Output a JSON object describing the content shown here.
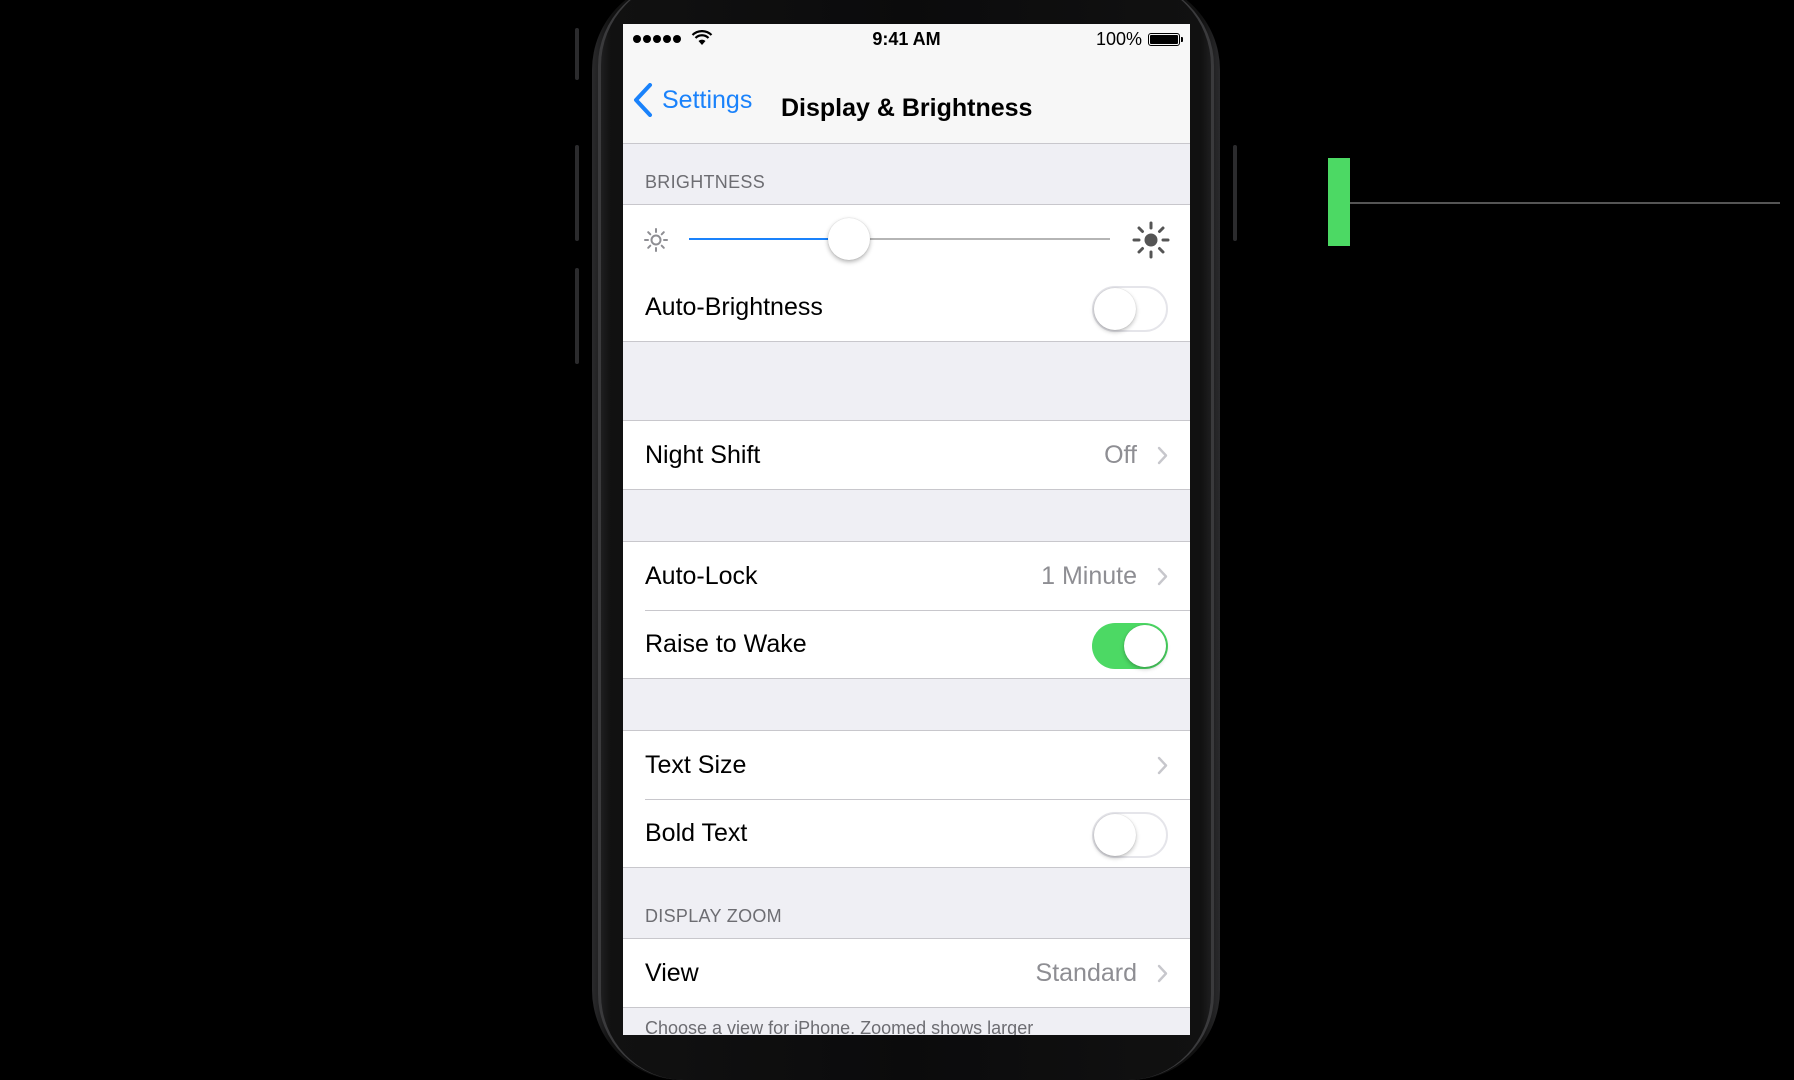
{
  "status_bar": {
    "time": "9:41 AM",
    "battery": "100%",
    "signal_bars": 5
  },
  "nav": {
    "back_label": "Settings",
    "title": "Display & Brightness"
  },
  "sections": {
    "brightness": {
      "header": "BRIGHTNESS",
      "slider_level": 0.38,
      "auto_brightness": {
        "label": "Auto-Brightness",
        "on": false
      }
    },
    "night_shift": {
      "label": "Night Shift",
      "value": "Off"
    },
    "lock": {
      "auto_lock": {
        "label": "Auto-Lock",
        "value": "1 Minute"
      },
      "raise_to_wake": {
        "label": "Raise to Wake",
        "on": true
      }
    },
    "text": {
      "text_size": {
        "label": "Text Size"
      },
      "bold_text": {
        "label": "Bold Text",
        "on": false
      }
    },
    "display_zoom": {
      "header": "DISPLAY ZOOM",
      "view": {
        "label": "View",
        "value": "Standard"
      },
      "footer": "Choose a view for iPhone. Zoomed shows larger"
    }
  },
  "colors": {
    "accent": "#1a82fb",
    "toggle_on": "#4cd964",
    "background": "#efeff4",
    "indicator": "#4cd964"
  },
  "icons": [
    "wifi-icon",
    "back-chevron-icon",
    "sun-small-icon",
    "sun-large-icon",
    "chevron-right-icon"
  ]
}
